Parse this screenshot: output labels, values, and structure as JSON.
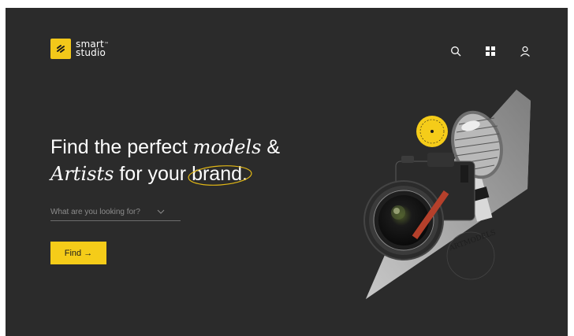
{
  "brand": {
    "line1": "smart",
    "tm": "™",
    "line2": "studio"
  },
  "header": {
    "icons": [
      "search-icon",
      "grid-icon",
      "user-icon"
    ]
  },
  "hero": {
    "text1": "Find the perfect ",
    "italic1": "models",
    "text2": " &",
    "italic2": "Artists",
    "text3": " for your ",
    "brand_word": "brand",
    "text4": "."
  },
  "search": {
    "placeholder": "What are you looking for?"
  },
  "cta": {
    "label": "Find →"
  },
  "badge": {
    "text": "SMART MODELS"
  },
  "ring_text": "ARTMODELS",
  "colors": {
    "background": "#2b2b2b",
    "accent": "#f5cc19",
    "text": "#ffffff"
  }
}
